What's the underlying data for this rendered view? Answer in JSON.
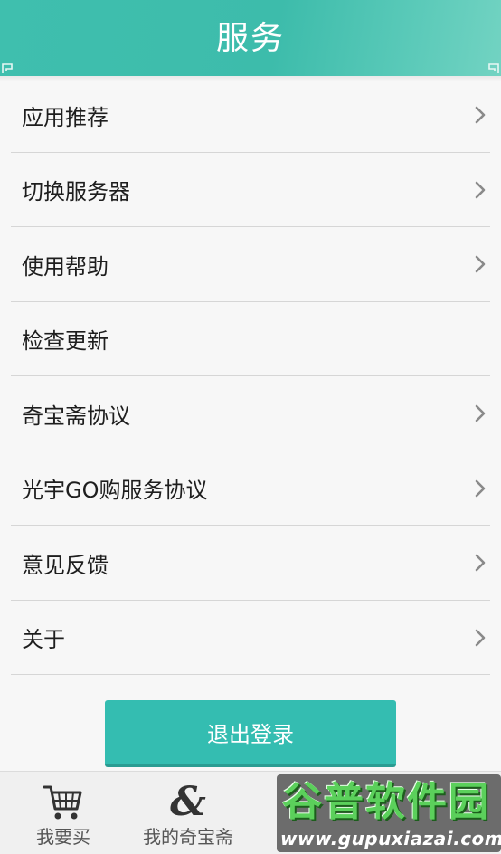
{
  "header": {
    "title": "服务"
  },
  "menu": {
    "items": [
      {
        "label": "应用推荐",
        "has_chevron": true
      },
      {
        "label": "切换服务器",
        "has_chevron": true
      },
      {
        "label": "使用帮助",
        "has_chevron": true
      },
      {
        "label": "检查更新",
        "has_chevron": false
      },
      {
        "label": "奇宝斋协议",
        "has_chevron": true
      },
      {
        "label": "光宇GO购服务协议",
        "has_chevron": true
      },
      {
        "label": "意见反馈",
        "has_chevron": true
      },
      {
        "label": "关于",
        "has_chevron": true
      }
    ]
  },
  "logout": {
    "label": "退出登录"
  },
  "tabbar": {
    "tabs": [
      {
        "label": "我要买",
        "icon": "cart-icon"
      },
      {
        "label": "我的奇宝斋",
        "icon": "ampersand-icon"
      }
    ]
  },
  "watermark": {
    "title": "谷普软件园",
    "url": "www.gupuxiazai.com"
  },
  "colors": {
    "accent": "#34bdb1",
    "header": "#3fbfae"
  }
}
